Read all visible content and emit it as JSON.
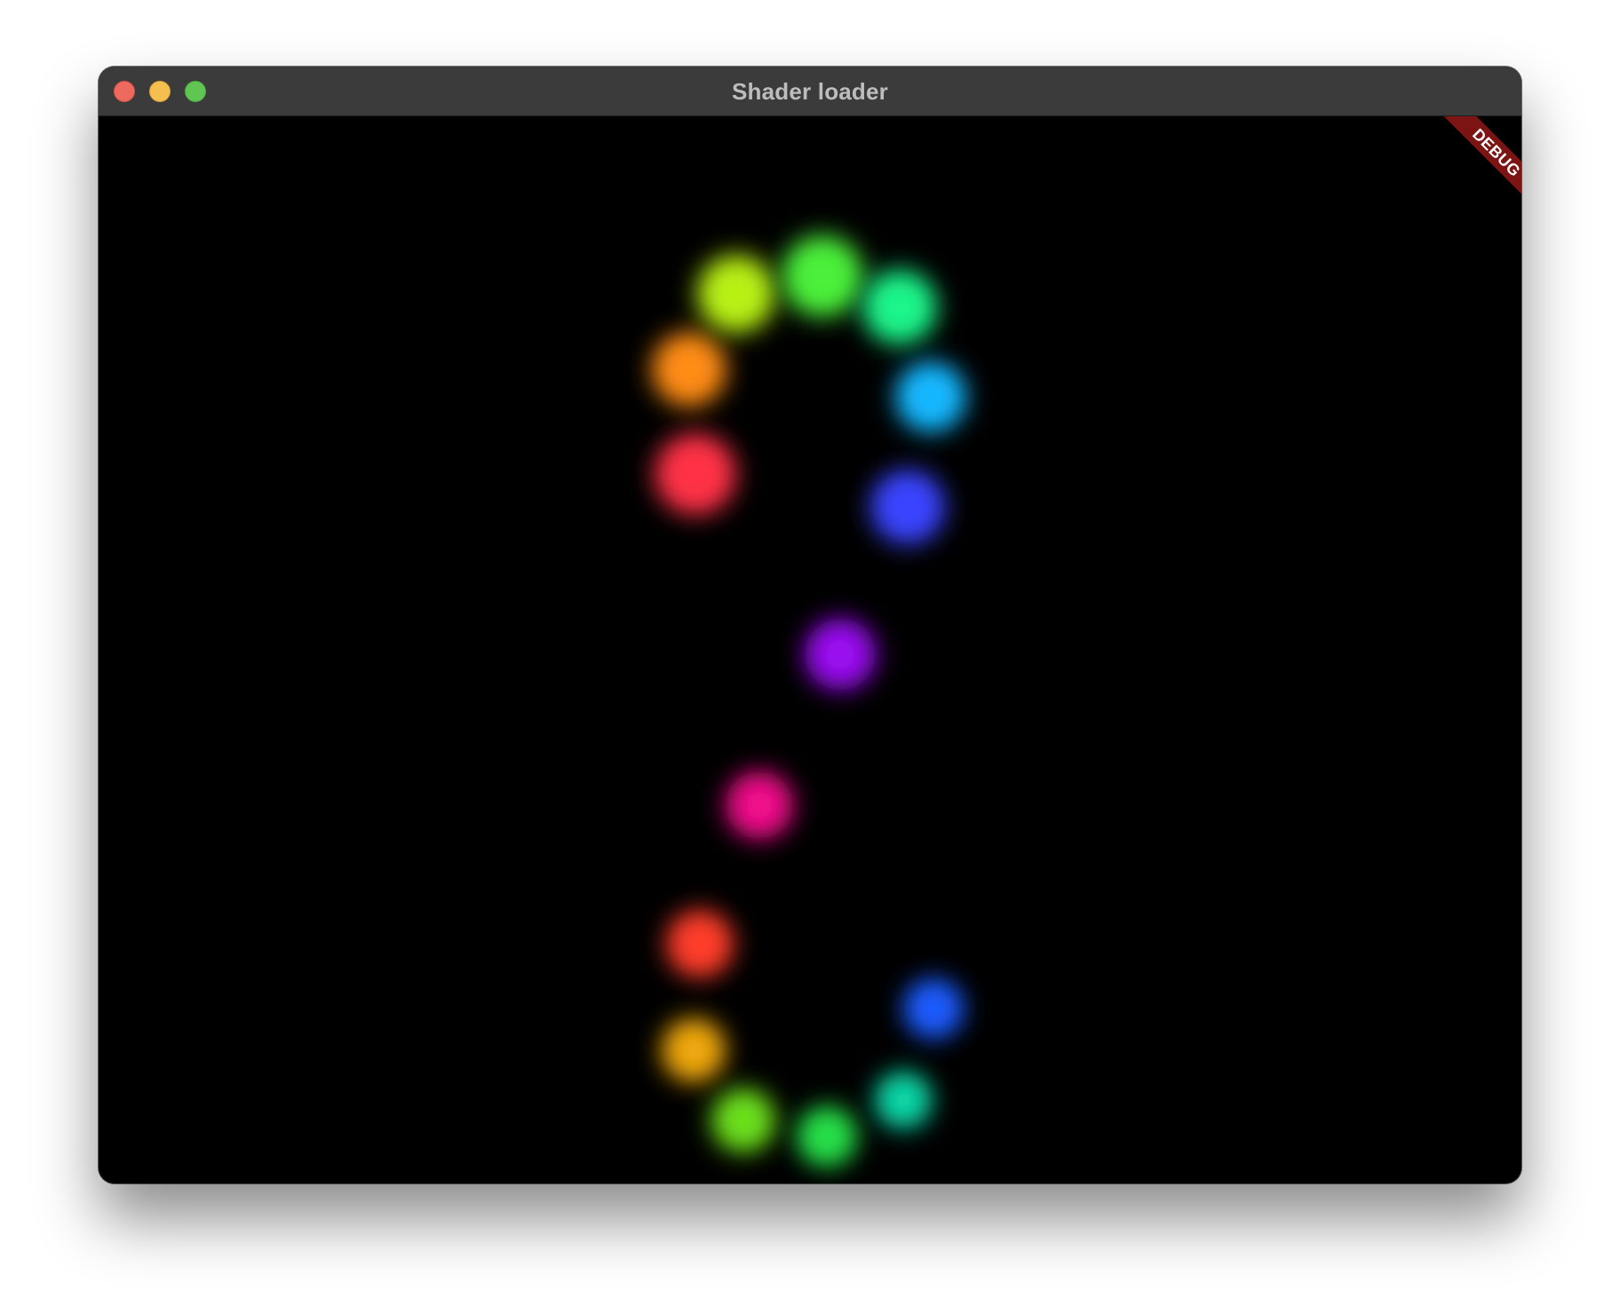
{
  "window": {
    "title": "Shader loader",
    "controls": {
      "close_color": "#ee6a5f",
      "minimize_color": "#f5bf4f",
      "zoom_color": "#61c554"
    }
  },
  "debug_banner": {
    "label": "DEBUG",
    "color": "#7d1414"
  },
  "canvas": {
    "background": "#000000",
    "glow_dots": [
      {
        "name": "red-dot",
        "color": "#ff3346"
      },
      {
        "name": "orange-dot",
        "color": "#ff8c14"
      },
      {
        "name": "yellow-green-dot",
        "color": "#b8f016"
      },
      {
        "name": "green-dot",
        "color": "#4cf03a"
      },
      {
        "name": "spring-green-dot",
        "color": "#1cf58a"
      },
      {
        "name": "sky-blue-dot",
        "color": "#14b8ff"
      },
      {
        "name": "blue-dot",
        "color": "#3a44ff"
      },
      {
        "name": "purple-dot",
        "color": "#9a10f0"
      },
      {
        "name": "magenta-dot",
        "color": "#f0108a"
      },
      {
        "name": "lower-red-dot",
        "color": "#ff3c2c"
      },
      {
        "name": "lower-blue-dot",
        "color": "#1c5cff"
      },
      {
        "name": "lower-gold-dot",
        "color": "#f0a80c"
      },
      {
        "name": "lower-lime-dot",
        "color": "#6ce01a"
      },
      {
        "name": "lower-green-dot",
        "color": "#28e04a"
      },
      {
        "name": "lower-teal-dot",
        "color": "#10d8a8"
      }
    ]
  }
}
